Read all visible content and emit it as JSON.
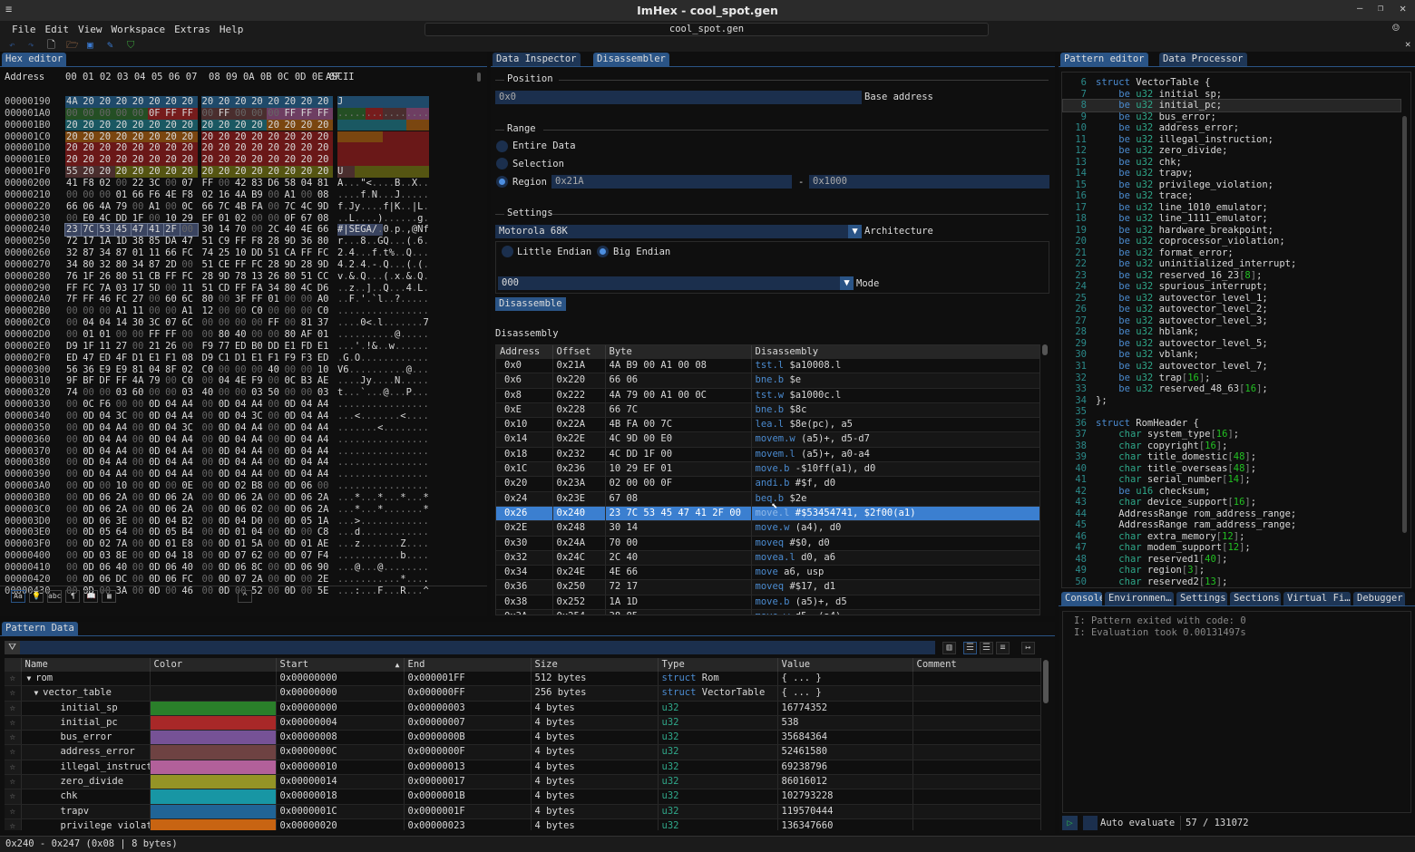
{
  "window": {
    "title": "ImHex - cool_spot.gen",
    "search_value": "cool_spot.gen"
  },
  "menu": [
    "File",
    "Edit",
    "View",
    "Workspace",
    "Extras",
    "Help"
  ],
  "hex_editor": {
    "tab": "Hex editor",
    "header_address": "Address",
    "header_columns": "00 01 02 03 04 05 06 07  08 09 0A 0B 0C 0D 0E 0F",
    "header_ascii": "ASCII",
    "rows": [
      {
        "a": "00000190",
        "b": "4A 20 20 20 20 20 20 20 20 20 20 20 20 20 20 20",
        "hl": [
          [
            0,
            15,
            "#1f4a6a"
          ]
        ]
      },
      {
        "a": "000001A0",
        "b": "00 00 00 00 00 0F FF FF 00 FF 00 00 00 FF FF FF",
        "hl": [
          [
            0,
            4,
            "#244f24"
          ],
          [
            5,
            7,
            "#761c1c"
          ],
          [
            8,
            11,
            "#4a2e2e"
          ],
          [
            12,
            15,
            "#6e3e62"
          ]
        ]
      },
      {
        "a": "000001B0",
        "b": "20 20 20 20 20 20 20 20 20 20 20 20 20 20 20 20",
        "hl": [
          [
            0,
            11,
            "#1a5862"
          ],
          [
            12,
            15,
            "#7a4610"
          ]
        ]
      },
      {
        "a": "000001C0",
        "b": "20 20 20 20 20 20 20 20 20 20 20 20 20 20 20 20",
        "hl": [
          [
            0,
            7,
            "#7a4610"
          ],
          [
            8,
            15,
            "#6a1818"
          ]
        ]
      },
      {
        "a": "000001D0",
        "b": "20 20 20 20 20 20 20 20 20 20 20 20 20 20 20 20",
        "hl": [
          [
            0,
            15,
            "#6a1818"
          ]
        ]
      },
      {
        "a": "000001E0",
        "b": "20 20 20 20 20 20 20 20 20 20 20 20 20 20 20 20",
        "hl": [
          [
            0,
            15,
            "#6a1818"
          ]
        ]
      },
      {
        "a": "000001F0",
        "b": "55 20 20 20 20 20 20 20 20 20 20 20 20 20 20 20",
        "hl": [
          [
            0,
            2,
            "#4a2e2e"
          ],
          [
            3,
            15,
            "#555512"
          ]
        ]
      },
      {
        "a": "00000200",
        "b": "41 F8 02 00 22 3C 00 07 FF 00 42 83 D6 58 04 81"
      },
      {
        "a": "00000210",
        "b": "00 00 00 01 66 F6 4E F8 02 16 4A B9 00 A1 00 08"
      },
      {
        "a": "00000220",
        "b": "66 06 4A 79 00 A1 00 0C 66 7C 4B FA 00 7C 4C 9D"
      },
      {
        "a": "00000230",
        "b": "00 E0 4C DD 1F 00 10 29 EF 01 02 00 00 0F 67 08"
      },
      {
        "a": "00000240",
        "b": "23 7C 53 45 47 41 2F 00 30 14 70 00 2C 40 4E 66",
        "hl": [
          [
            0,
            7,
            "#3a4460"
          ]
        ]
      },
      {
        "a": "00000250",
        "b": "72 17 1A 1D 38 85 DA 47 51 C9 FF F8 28 9D 36 80"
      },
      {
        "a": "00000260",
        "b": "32 87 34 87 01 11 66 FC 74 25 10 DD 51 CA FF FC"
      },
      {
        "a": "00000270",
        "b": "34 80 32 80 34 87 2D 00 51 CE FF FC 28 9D 28 9D"
      },
      {
        "a": "00000280",
        "b": "76 1F 26 80 51 CB FF FC 28 9D 78 13 26 80 51 CC"
      },
      {
        "a": "00000290",
        "b": "FF FC 7A 03 17 5D 00 11 51 CD FF FA 34 80 4C D6"
      },
      {
        "a": "000002A0",
        "b": "7F FF 46 FC 27 00 60 6C 80 00 3F FF 01 00 00 A0"
      },
      {
        "a": "000002B0",
        "b": "00 00 00 A1 11 00 00 A1 12 00 00 C0 00 00 00 C0"
      },
      {
        "a": "000002C0",
        "b": "00 04 04 14 30 3C 07 6C 00 00 00 00 FF 00 81 37"
      },
      {
        "a": "000002D0",
        "b": "00 01 01 00 00 FF FF 00 00 80 40 00 00 80 AF 01"
      },
      {
        "a": "000002E0",
        "b": "D9 1F 11 27 00 21 26 00 F9 77 ED B0 DD E1 FD E1"
      },
      {
        "a": "000002F0",
        "b": "ED 47 ED 4F D1 E1 F1 08 D9 C1 D1 E1 F1 F9 F3 ED"
      },
      {
        "a": "00000300",
        "b": "56 36 E9 E9 81 04 8F 02 C0 00 00 00 40 00 00 10"
      },
      {
        "a": "00000310",
        "b": "9F BF DF FF 4A 79 00 C0 00 04 4E F9 00 0C B3 AE"
      },
      {
        "a": "00000320",
        "b": "74 00 00 03 60 00 00 03 40 00 00 03 50 00 00 03"
      },
      {
        "a": "00000330",
        "b": "00 0C F6 00 00 0D 04 A4 00 0D 04 A4 00 0D 04 A4"
      },
      {
        "a": "00000340",
        "b": "00 0D 04 3C 00 0D 04 A4 00 0D 04 3C 00 0D 04 A4"
      },
      {
        "a": "00000350",
        "b": "00 0D 04 A4 00 0D 04 3C 00 0D 04 A4 00 0D 04 A4"
      },
      {
        "a": "00000360",
        "b": "00 0D 04 A4 00 0D 04 A4 00 0D 04 A4 00 0D 04 A4"
      },
      {
        "a": "00000370",
        "b": "00 0D 04 A4 00 0D 04 A4 00 0D 04 A4 00 0D 04 A4"
      },
      {
        "a": "00000380",
        "b": "00 0D 04 A4 00 0D 04 A4 00 0D 04 A4 00 0D 04 A4"
      },
      {
        "a": "00000390",
        "b": "00 0D 04 A4 00 0D 04 A4 00 0D 04 A4 00 0D 04 A4"
      },
      {
        "a": "000003A0",
        "b": "00 0D 00 10 00 0D 00 0E 00 0D 02 B8 00 0D 06 00"
      },
      {
        "a": "000003B0",
        "b": "00 0D 06 2A 00 0D 06 2A 00 0D 06 2A 00 0D 06 2A"
      },
      {
        "a": "000003C0",
        "b": "00 0D 06 2A 00 0D 06 2A 00 0D 06 02 00 0D 06 2A"
      },
      {
        "a": "000003D0",
        "b": "00 0D 06 3E 00 0D 04 B2 00 0D 04 D0 00 0D 05 1A"
      },
      {
        "a": "000003E0",
        "b": "00 0D 05 64 00 0D 05 B4 00 0D 01 04 00 0D 00 C8"
      },
      {
        "a": "000003F0",
        "b": "00 0D 02 7A 00 0D 01 E8 00 0D 01 5A 00 0D 01 AE"
      },
      {
        "a": "00000400",
        "b": "00 0D 03 8E 00 0D 04 18 00 0D 07 62 00 0D 07 F4"
      },
      {
        "a": "00000410",
        "b": "00 0D 06 40 00 0D 06 40 00 0D 06 8C 00 0D 06 90"
      },
      {
        "a": "00000420",
        "b": "00 0D 06 DC 00 0D 06 FC 00 0D 07 2A 00 0D 00 2E"
      },
      {
        "a": "00000430",
        "b": "00 0D 00 3A 00 0D 00 46 00 0D 00 52 00 0D 00 5E"
      }
    ],
    "footer_icons": [
      "Aa",
      "bulb",
      "abc",
      "¶",
      "book",
      "grid"
    ]
  },
  "disassembler": {
    "tabs": [
      "Data Inspector",
      "Disassembler"
    ],
    "position_label": "Position",
    "position_value": "0x0",
    "base_address_label": "Base address",
    "range_label": "Range",
    "range_options": [
      "Entire Data",
      "Selection",
      "Region"
    ],
    "range_selected": "Region",
    "region_start": "0x21A",
    "region_sep": "-",
    "region_end": "0x1000",
    "settings_label": "Settings",
    "architecture_value": "Motorola 68K",
    "architecture_label": "Architecture",
    "endian_options": [
      "Little Endian",
      "Big Endian"
    ],
    "endian_selected": "Big Endian",
    "mode_value": "000",
    "mode_label": "Mode",
    "disassemble_button": "Disassemble",
    "disassembly_label": "Disassembly",
    "columns": [
      "Address",
      "Offset",
      "Byte",
      "Disassembly"
    ],
    "rows": [
      [
        "0x0",
        "0x21A",
        "4A B9 00 A1 00 08",
        "tst.l",
        "$a10008.l"
      ],
      [
        "0x6",
        "0x220",
        "66 06",
        "bne.b",
        "$e"
      ],
      [
        "0x8",
        "0x222",
        "4A 79 00 A1 00 0C",
        "tst.w",
        "$a1000c.l"
      ],
      [
        "0xE",
        "0x228",
        "66 7C",
        "bne.b",
        "$8c"
      ],
      [
        "0x10",
        "0x22A",
        "4B FA 00 7C",
        "lea.l",
        "$8e(pc), a5"
      ],
      [
        "0x14",
        "0x22E",
        "4C 9D 00 E0",
        "movem.w",
        "(a5)+, d5-d7"
      ],
      [
        "0x18",
        "0x232",
        "4C DD 1F 00",
        "movem.l",
        "(a5)+, a0-a4"
      ],
      [
        "0x1C",
        "0x236",
        "10 29 EF 01",
        "move.b",
        "-$10ff(a1), d0"
      ],
      [
        "0x20",
        "0x23A",
        "02 00 00 0F",
        "andi.b",
        "#$f, d0"
      ],
      [
        "0x24",
        "0x23E",
        "67 08",
        "beq.b",
        "$2e"
      ],
      [
        "0x26",
        "0x240",
        "23 7C 53 45 47 41 2F 00",
        "move.l",
        "#$53454741, $2f00(a1)"
      ],
      [
        "0x2E",
        "0x248",
        "30 14",
        "move.w",
        "(a4), d0"
      ],
      [
        "0x30",
        "0x24A",
        "70 00",
        "moveq",
        "#$0, d0"
      ],
      [
        "0x32",
        "0x24C",
        "2C 40",
        "movea.l",
        "d0, a6"
      ],
      [
        "0x34",
        "0x24E",
        "4E 66",
        "move",
        "a6, usp"
      ],
      [
        "0x36",
        "0x250",
        "72 17",
        "moveq",
        "#$17, d1"
      ],
      [
        "0x38",
        "0x252",
        "1A 1D",
        "move.b",
        "(a5)+, d5"
      ],
      [
        "0x3A",
        "0x254",
        "38 85",
        "move.w",
        "d5, (a4)"
      ]
    ],
    "selected_row": "0x26"
  },
  "pattern_editor": {
    "tabs": [
      "Pattern editor",
      "Data Processor"
    ],
    "first_line": 6,
    "highlighted_line": 8,
    "lines": [
      "struct VectorTable {",
      "    be u32 initial_sp;",
      "    be u32 initial_pc;",
      "    be u32 bus_error;",
      "    be u32 address_error;",
      "    be u32 illegal_instruction;",
      "    be u32 zero_divide;",
      "    be u32 chk;",
      "    be u32 trapv;",
      "    be u32 privilege_violation;",
      "    be u32 trace;",
      "    be u32 line_1010_emulator;",
      "    be u32 line_1111_emulator;",
      "    be u32 hardware_breakpoint;",
      "    be u32 coprocessor_violation;",
      "    be u32 format_error;",
      "    be u32 uninitialized_interrupt;",
      "    be u32 reserved_16_23[8];",
      "    be u32 spurious_interrupt;",
      "    be u32 autovector_level_1;",
      "    be u32 autovector_level_2;",
      "    be u32 autovector_level_3;",
      "    be u32 hblank;",
      "    be u32 autovector_level_5;",
      "    be u32 vblank;",
      "    be u32 autovector_level_7;",
      "    be u32 trap[16];",
      "    be u32 reserved_48_63[16];",
      "};",
      "",
      "struct RomHeader {",
      "    char system_type[16];",
      "    char copyright[16];",
      "    char title_domestic[48];",
      "    char title_overseas[48];",
      "    char serial_number[14];",
      "    be u16 checksum;",
      "    char device_support[16];",
      "    AddressRange rom_address_range;",
      "    AddressRange ram_address_range;",
      "    char extra_memory[12];",
      "    char modem_support[12];",
      "    char reserved1[40];",
      "    char region[3];",
      "    char reserved2[13];"
    ]
  },
  "console": {
    "tabs": [
      "Console",
      "Environmen…",
      "Settings",
      "Sections",
      "Virtual Fi…",
      "Debugger"
    ],
    "lines": [
      "I: Pattern exited with code: 0",
      "I: Evaluation took 0.00131497s"
    ],
    "auto_evaluate_label": "Auto evaluate",
    "progress": "57 / 131072"
  },
  "pattern_data": {
    "tab": "Pattern Data",
    "columns": [
      "Name",
      "Color",
      "Start",
      "End",
      "Size",
      "Type",
      "Value",
      "Comment"
    ],
    "rows": [
      {
        "name": "rom",
        "indent": 0,
        "expand": "▼",
        "color": "",
        "start": "0x00000000",
        "end": "0x000001FF",
        "size": "512 bytes",
        "tkw": "struct",
        "type": "Rom",
        "value": "{ ... }"
      },
      {
        "name": "vector_table",
        "indent": 1,
        "expand": "▼",
        "color": "",
        "start": "0x00000000",
        "end": "0x000000FF",
        "size": "256 bytes",
        "tkw": "struct",
        "type": "VectorTable",
        "value": "{ ... }"
      },
      {
        "name": "initial_sp",
        "indent": 2,
        "color": "#2a7f2a",
        "start": "0x00000000",
        "end": "0x00000003",
        "size": "4 bytes",
        "type": "u32",
        "value": "16774352"
      },
      {
        "name": "initial_pc",
        "indent": 2,
        "color": "#a82828",
        "start": "0x00000004",
        "end": "0x00000007",
        "size": "4 bytes",
        "type": "u32",
        "value": "538"
      },
      {
        "name": "bus_error",
        "indent": 2,
        "color": "#765296",
        "start": "0x00000008",
        "end": "0x0000000B",
        "size": "4 bytes",
        "type": "u32",
        "value": "35684364"
      },
      {
        "name": "address_error",
        "indent": 2,
        "color": "#6e4242",
        "start": "0x0000000C",
        "end": "0x0000000F",
        "size": "4 bytes",
        "type": "u32",
        "value": "52461580"
      },
      {
        "name": "illegal_instruction",
        "indent": 2,
        "color": "#b2609a",
        "start": "0x00000010",
        "end": "0x00000013",
        "size": "4 bytes",
        "type": "u32",
        "value": "69238796"
      },
      {
        "name": "zero_divide",
        "indent": 2,
        "color": "#949426",
        "start": "0x00000014",
        "end": "0x00000017",
        "size": "4 bytes",
        "type": "u32",
        "value": "86016012"
      },
      {
        "name": "chk",
        "indent": 2,
        "color": "#1896a4",
        "start": "0x00000018",
        "end": "0x0000001B",
        "size": "4 bytes",
        "type": "u32",
        "value": "102793228"
      },
      {
        "name": "trapv",
        "indent": 2,
        "color": "#206496",
        "start": "0x0000001C",
        "end": "0x0000001F",
        "size": "4 bytes",
        "type": "u32",
        "value": "119570444"
      },
      {
        "name": "privilege_violation",
        "indent": 2,
        "color": "#c86412",
        "start": "0x00000020",
        "end": "0x00000023",
        "size": "4 bytes",
        "type": "u32",
        "value": "136347660"
      }
    ]
  },
  "status_bar": "0x240 - 0x247 (0x08 | 8 bytes)"
}
